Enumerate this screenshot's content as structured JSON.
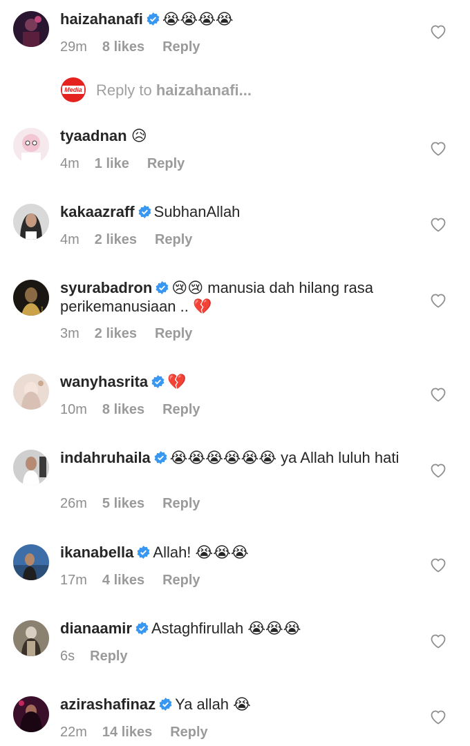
{
  "comments": [
    {
      "username": "haizahanafi",
      "verified": true,
      "text": "😭😭😭😭",
      "time": "29m",
      "likes": "8 likes",
      "reply": "Reply",
      "avatar": "haizahanafi-avatar"
    },
    {
      "username": "tyaadnan",
      "verified": false,
      "text": "😥",
      "time": "4m",
      "likes": "1 like",
      "reply": "Reply",
      "avatar": "tyaadnan-avatar"
    },
    {
      "username": "kakaazraff",
      "verified": true,
      "text": "SubhanAllah",
      "time": "4m",
      "likes": "2 likes",
      "reply": "Reply",
      "avatar": "kakaazraff-avatar"
    },
    {
      "username": "syurabadron",
      "verified": true,
      "text": "😢😢 manusia dah hilang rasa perikemanusiaan .. 💔",
      "time": "3m",
      "likes": "2 likes",
      "reply": "Reply",
      "avatar": "syurabadron-avatar"
    },
    {
      "username": "wanyhasrita",
      "verified": true,
      "text": "💔",
      "time": "10m",
      "likes": "8 likes",
      "reply": "Reply",
      "avatar": "wanyhasrita-avatar"
    },
    {
      "username": "indahruhaila",
      "verified": true,
      "text": "😭😭😭😭😭😭 ya Allah luluh hati",
      "time": "26m",
      "likes": "5 likes",
      "reply": "Reply",
      "avatar": "indahruhaila-avatar"
    },
    {
      "username": "ikanabella",
      "verified": true,
      "text": "Allah! 😭😭😭",
      "time": "17m",
      "likes": "4 likes",
      "reply": "Reply",
      "avatar": "ikanabella-avatar"
    },
    {
      "username": "dianaamir",
      "verified": true,
      "text": "Astaghfirullah 😭😭😭",
      "time": "6s",
      "likes": "",
      "reply": "Reply",
      "avatar": "dianaamir-avatar"
    },
    {
      "username": "azirashafinaz",
      "verified": true,
      "text": "Ya allah 😭",
      "time": "22m",
      "likes": "14 likes",
      "reply": "Reply",
      "avatar": "azirashafinaz-avatar"
    }
  ],
  "reply_composer": {
    "logo_text": "Media",
    "prefix": "Reply to ",
    "target": "haizahanafi..."
  },
  "colors": {
    "username": "#262626",
    "meta": "#8e8e8e",
    "verified": "#3897f0",
    "heart_outline": "#8e8e8e",
    "media_logo": "#e4221f"
  },
  "icons": {
    "verified": "verified-badge-icon",
    "like": "heart-outline-icon"
  }
}
